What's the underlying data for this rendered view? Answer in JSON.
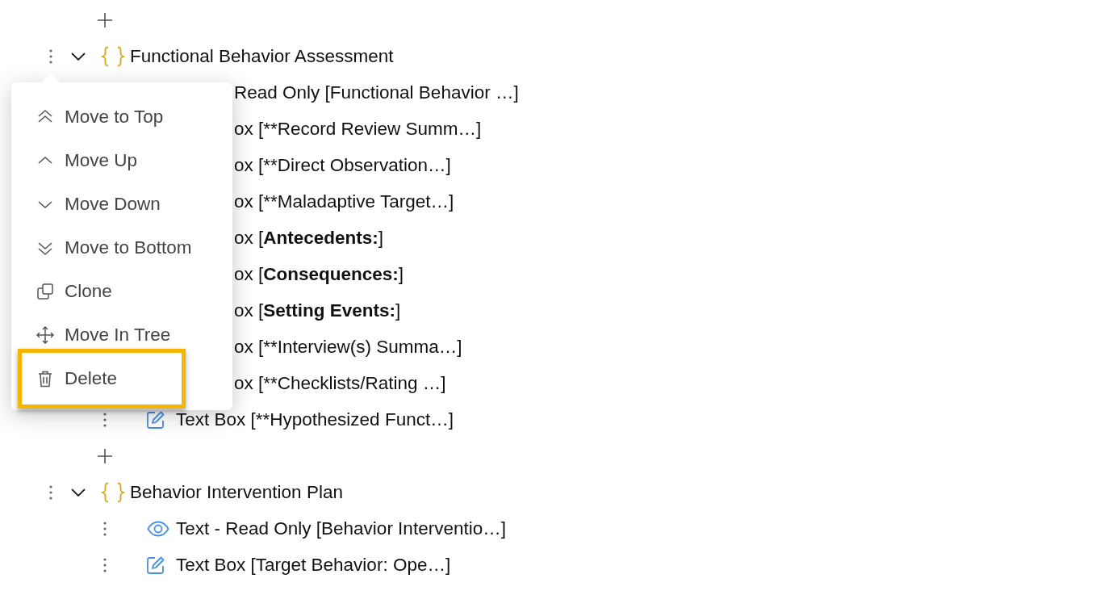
{
  "tree": [
    {
      "kind": "add"
    },
    {
      "kind": "group",
      "label": "Functional Behavior Assessment",
      "expanded": true,
      "children": [
        {
          "text": "Read Only [Functional Behavior …]"
        },
        {
          "text": "ox [**Record Review Summ…]"
        },
        {
          "text": "ox [**Direct Observation…]"
        },
        {
          "text": "ox [**Maladaptive Target…]"
        },
        {
          "text": "ox [",
          "bold": "Antecedents:",
          "after": "]"
        },
        {
          "text": "ox [",
          "bold": "Consequences:",
          "after": "]"
        },
        {
          "text": "ox [",
          "bold": "Setting Events:",
          "after": "]"
        },
        {
          "text": "ox [**Interview(s) Summa…]"
        },
        {
          "text": "ox [**Checklists/Rating …]"
        },
        {
          "kind": "text_box",
          "text": "Text Box [**Hypothesized Funct…]"
        }
      ]
    },
    {
      "kind": "add"
    },
    {
      "kind": "group",
      "label": "Behavior Intervention Plan",
      "expanded": true,
      "children": [
        {
          "kind": "read_only",
          "text": "Text - Read Only [Behavior Interventio…]"
        },
        {
          "kind": "text_box",
          "text": "Text Box [Target Behavior: Ope…]"
        }
      ]
    }
  ],
  "menu": {
    "items": [
      {
        "kind": "top",
        "label": "Move to Top",
        "highlighted": false
      },
      {
        "kind": "up",
        "label": "Move Up",
        "highlighted": false
      },
      {
        "kind": "down",
        "label": "Move Down",
        "highlighted": false
      },
      {
        "kind": "bottom",
        "label": "Move to Bottom",
        "highlighted": false
      },
      {
        "kind": "clone",
        "label": "Clone",
        "highlighted": false
      },
      {
        "kind": "move",
        "label": "Move In Tree",
        "highlighted": false
      },
      {
        "kind": "delete",
        "label": "Delete",
        "highlighted": true
      }
    ]
  }
}
